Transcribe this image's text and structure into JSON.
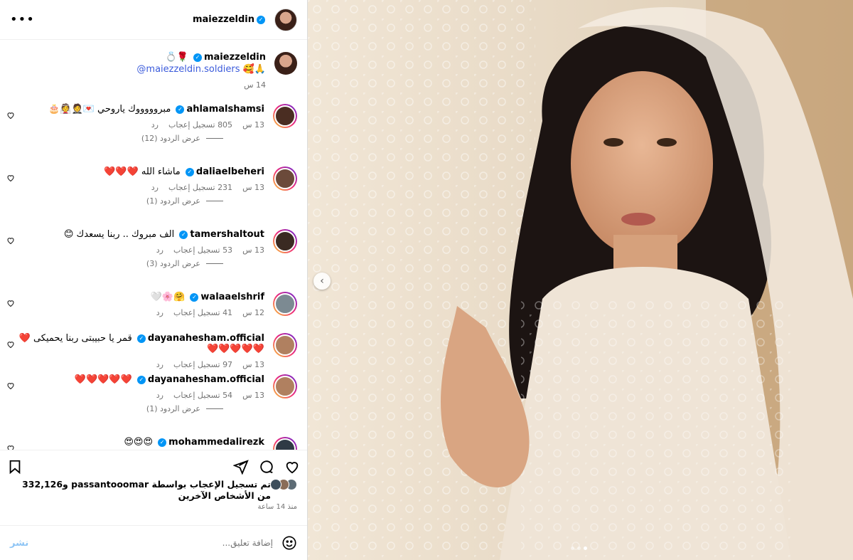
{
  "post": {
    "author": "maiezzeldin",
    "caption_emoji": "🌹💍",
    "caption_mention": "@maiezzeldin.soldiers",
    "caption_emoji2": "🙏🥰",
    "caption_time": "14 س"
  },
  "labels": {
    "like_label": "تسجيل إعجاب",
    "reply_label": "رد",
    "more_icon": "more-horizontal-icon"
  },
  "comments": [
    {
      "user": "ahlamalshamsi",
      "text": "مبروووووك ياروحي 💌🤵👰🎂",
      "time": "13 س",
      "likes": "805",
      "replies": "عرض الردود (12)",
      "avatar_color": "#4a2d22"
    },
    {
      "user": "daliaelbeheri",
      "text": "ماشاء الله ❤️❤️❤️",
      "time": "13 س",
      "likes": "231",
      "replies": "عرض الردود (1)",
      "avatar_color": "#6b4a3a"
    },
    {
      "user": "tamershaltout",
      "text": "الف مبروك .. ربنا يسعدك 😊",
      "time": "13 س",
      "likes": "53",
      "replies": "عرض الردود (3)",
      "avatar_color": "#3a2a22"
    },
    {
      "user": "walaaelshrif",
      "text": "🤗🌸🤍",
      "time": "12 س",
      "likes": "41",
      "replies": "",
      "avatar_color": "#7c8a92"
    },
    {
      "user": "dayanahesham.official",
      "text": "قمر يا حبيبتى ربنا يحميكى ❤️❤️❤️❤️❤️❤️",
      "time": "13 س",
      "likes": "97",
      "replies": "",
      "avatar_color": "#b08060"
    },
    {
      "user": "dayanahesham.official",
      "text": "❤️❤️❤️❤️❤️",
      "time": "13 س",
      "likes": "54",
      "replies": "عرض الردود (1)",
      "avatar_color": "#b08060"
    },
    {
      "user": "mohammedalirezk",
      "text": "😍😍😍",
      "time": "",
      "likes": "",
      "replies": "",
      "avatar_color": "#2f3a45"
    }
  ],
  "likes_summary": "تم تسجيل الإعجاب بواسطة passantooomar و332,126 من الأشخاص الآخرين",
  "posted_ago": "منذ 14 ساعة",
  "add_comment": {
    "placeholder": "إضافة تعليق...",
    "post_label": "نشر"
  },
  "carousel": {
    "prev": "‹",
    "current_index": 3,
    "count": 3
  },
  "colors": {
    "accent": "#0095f6",
    "post_button": "#8ec5f5"
  }
}
